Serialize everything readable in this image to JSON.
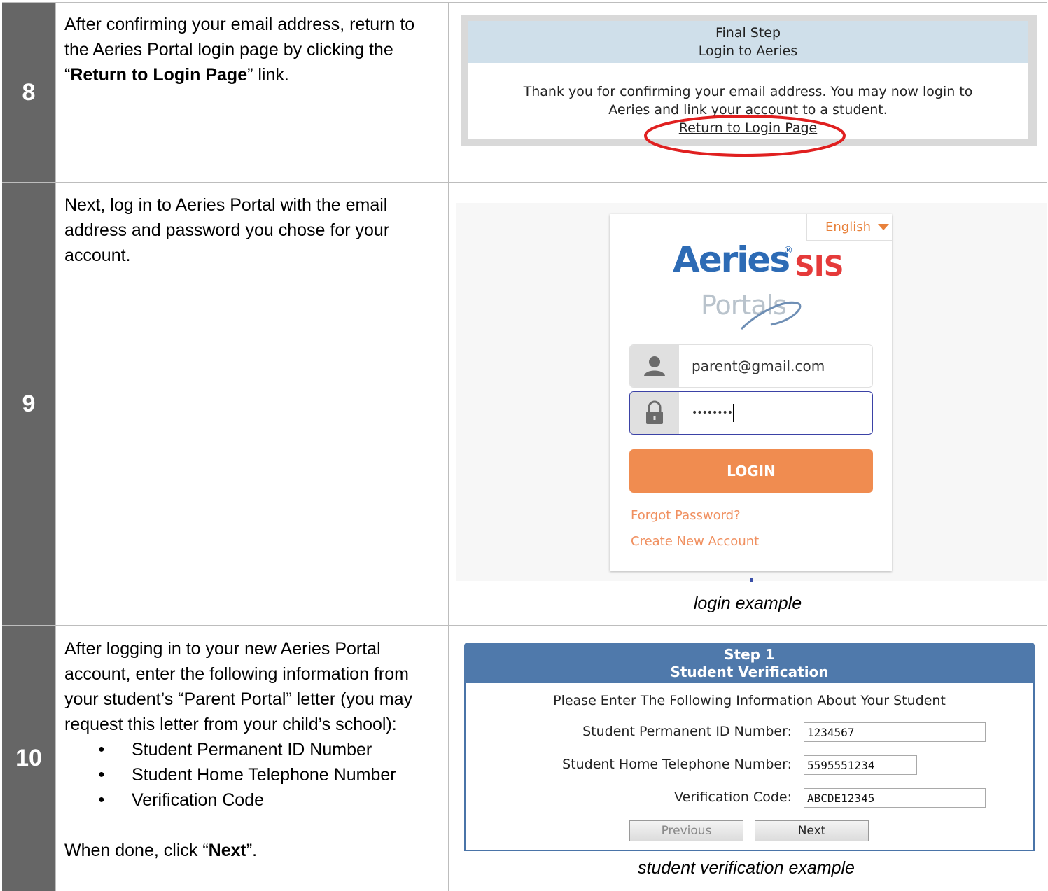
{
  "rows": {
    "step8": {
      "number": "8",
      "text_1": "After confirming your email address, return to the Aeries Portal login page by clicking the “",
      "text_bold": "Return to Login Page",
      "text_2": "” link.",
      "panel": {
        "heading_line1": "Final Step",
        "heading_line2": "Login to Aeries",
        "message_line1": "Thank you for confirming your email address. You may now login to",
        "message_line2": "Aeries and link your account to a student.",
        "link": "Return to Login Page",
        "highlight_color": "#e02020"
      }
    },
    "step9": {
      "number": "9",
      "text": "Next, log in to Aeries Portal with the email address and password you chose for your account.",
      "login": {
        "language": "English",
        "brand": "Aeries",
        "brand_mark": "®",
        "brand_suffix": "SIS",
        "portals": "Portals",
        "email_value": "parent@gmail.com",
        "password_value": "••••••••",
        "login_button": "LOGIN",
        "forgot_link": "Forgot Password?",
        "create_link": "Create New Account",
        "accent_color": "#f08c50",
        "brand_color": "#2d6bb5",
        "sis_color": "#e53a3a"
      },
      "caption": "login example"
    },
    "step10": {
      "number": "10",
      "intro": "After logging in to your new Aeries Portal account, enter the following information from your student’s “Parent Portal” letter (you may request this letter from your child’s school):",
      "bullets": [
        "Student Permanent ID Number",
        "Student Home Telephone Number",
        "Verification Code"
      ],
      "done_1": "When done, click “",
      "done_bold": "Next",
      "done_2": "”.",
      "panel": {
        "heading_line1": "Step 1",
        "heading_line2": "Student Verification",
        "instruction": "Please Enter The Following Information About Your Student",
        "id_label": "Student Permanent ID Number:",
        "id_value": "1234567",
        "phone_label": "Student Home Telephone Number:",
        "phone_value": "5595551234",
        "code_label": "Verification Code:",
        "code_value": "ABCDE12345",
        "previous_button": "Previous",
        "next_button": "Next",
        "header_color": "#4f79ab"
      },
      "caption": "student verification example"
    }
  }
}
